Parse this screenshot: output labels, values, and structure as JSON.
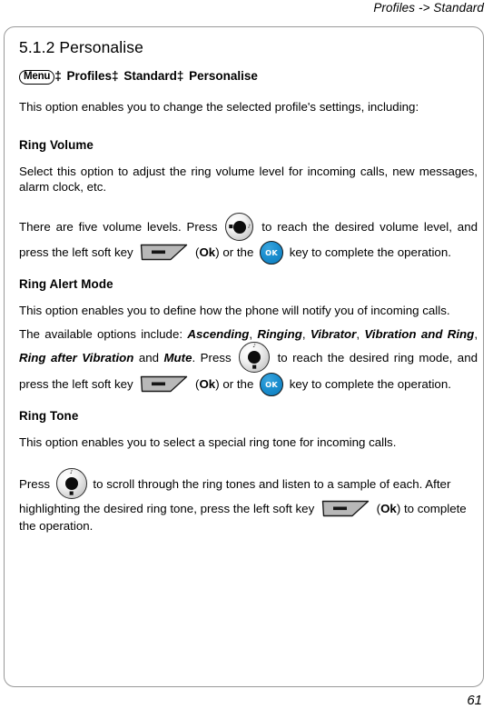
{
  "header": {
    "running_head": "Profiles -> Standard"
  },
  "section": {
    "number_title": "5.1.2 Personalise",
    "breadcrumb": {
      "menu_chip": "Menu",
      "separator": "‡",
      "steps": [
        "Profiles",
        "Standard",
        "Personalise"
      ]
    },
    "intro": "This option enables you to change the selected profile's settings, including:"
  },
  "ring_volume": {
    "heading": "Ring Volume",
    "para1": "Select this option to adjust the ring volume level for incoming calls, new messages, alarm clock, etc.",
    "para2_a": "There are five volume levels. Press",
    "para2_b": "to reach the desired volume level, and press the left soft key",
    "para2_ok": "Ok",
    "para2_c": "or the",
    "para2_d": "key to complete the operation.",
    "nav_icon": "navigation-key-horizontal-icon",
    "softkey_icon": "left-soft-key-icon",
    "ok_icon": "ok-key-icon",
    "ok_key_label": "OK"
  },
  "ring_alert_mode": {
    "heading": "Ring Alert Mode",
    "para1": "This option enables you to define how the phone will notify you of incoming calls.",
    "para2_lead": "The available options include:",
    "options": [
      "Ascending",
      "Ringing",
      "Vibrator",
      "Vibration and Ring",
      "Ring after Vibration",
      "Mute"
    ],
    "para2_and": "and",
    "para2_press": "Press",
    "para2_reach": "to reach the desired ring mode, and press the left soft key",
    "para2_ok": "Ok",
    "para2_or": "or the",
    "para2_tail": "key to complete the operation.",
    "nav_icon": "navigation-key-vertical-icon",
    "softkey_icon": "left-soft-key-icon",
    "ok_icon": "ok-key-icon",
    "ok_key_label": "OK"
  },
  "ring_tone": {
    "heading": "Ring Tone",
    "para1": "This option enables you to select a special ring tone for incoming calls.",
    "para2_press": "Press",
    "para2_b": "to scroll through the ring tones and listen to a sample of each. After highlighting the desired ring tone, press the left soft key",
    "para2_ok": "Ok",
    "para2_c": "to complete the operation.",
    "nav_icon": "navigation-key-vertical-icon",
    "softkey_icon": "left-soft-key-icon"
  },
  "footer": {
    "page_number": "61"
  },
  "colors": {
    "ok_key_blue": "#1b8fd0",
    "frame_border": "#999999",
    "softkey_gray": "#b8b8b8",
    "text": "#000000"
  }
}
